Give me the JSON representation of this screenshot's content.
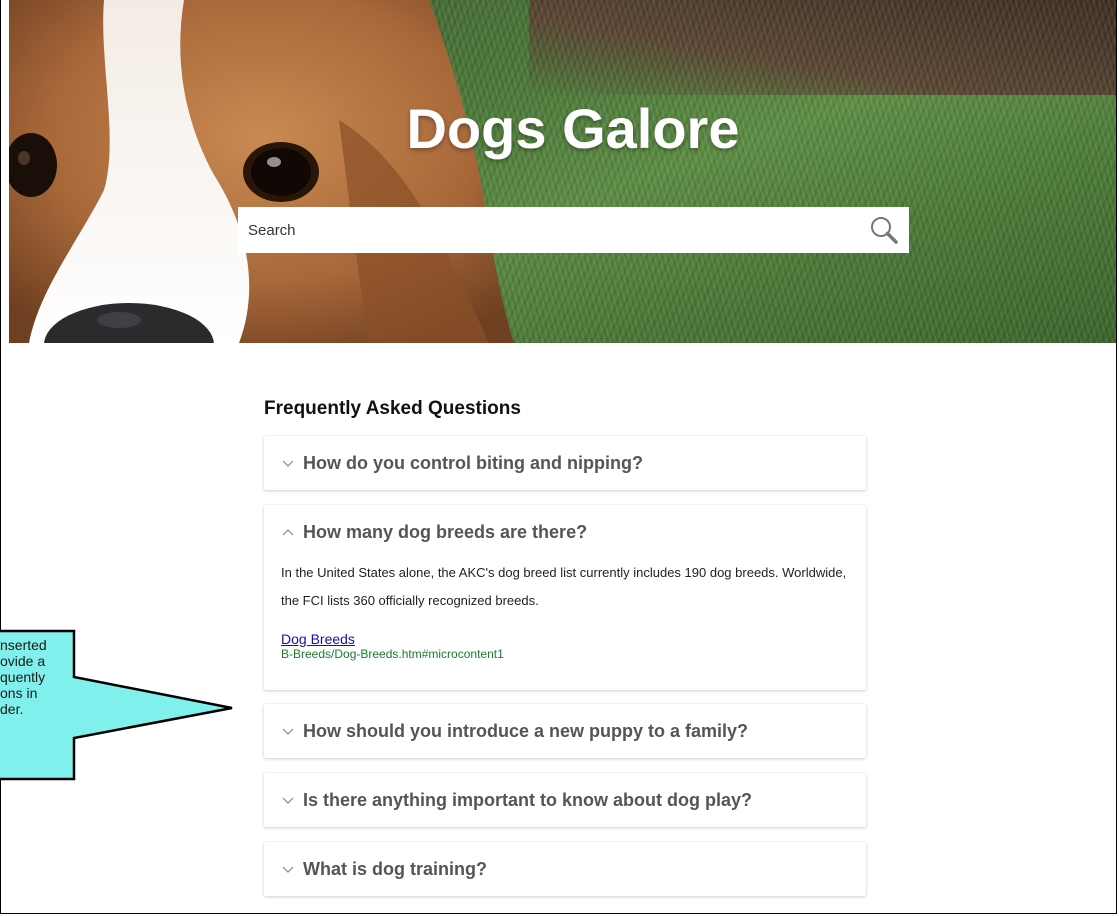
{
  "site": {
    "title": "Dogs Galore"
  },
  "search": {
    "placeholder": "Search"
  },
  "faq": {
    "heading": "Frequently Asked Questions",
    "items": [
      {
        "question": "How do you control biting and nipping?",
        "expanded": false
      },
      {
        "question": "How many dog breeds are there?",
        "expanded": true,
        "answer": "In the United States alone, the AKC's dog breed list currently includes 190 dog breeds. Worldwide, the FCI lists 360 officially recognized breeds.",
        "link_text": "Dog Breeds",
        "link_path": "B-Breeds/Dog-Breeds.htm#microcontent1"
      },
      {
        "question": "How should you introduce a new puppy to a family?",
        "expanded": false
      },
      {
        "question": "Is there anything important to know about dog play?",
        "expanded": false
      },
      {
        "question": "What is dog training?",
        "expanded": false
      }
    ]
  },
  "callout": {
    "lines": [
      "nserted",
      "ovide a",
      "quently",
      "ons in",
      "der."
    ],
    "fill": "#7ff0ec"
  },
  "icons": {
    "search": "search-icon",
    "collapsed": "chevron-down-icon",
    "expanded": "chevron-up-icon"
  }
}
